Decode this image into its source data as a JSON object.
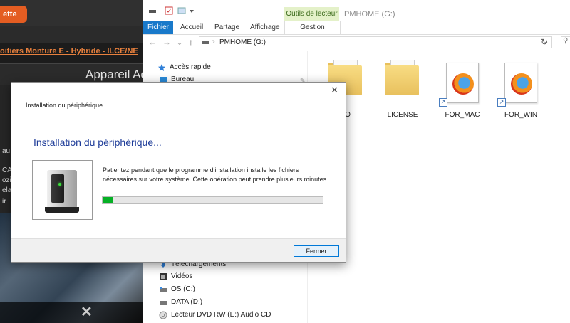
{
  "background_site": {
    "tab_label": "ette",
    "link_text": "oitiers Monture E - Hybride - ILCE/NE",
    "heading": "Appareil Ac",
    "side_text": [
      "au",
      "CAD",
      "ozil",
      "ela",
      "ir"
    ]
  },
  "explorer": {
    "tools_tab": "Outils de lecteur",
    "window_title": "PMHOME (G:)",
    "ribbon": {
      "file": "Fichier",
      "tabs": [
        "Accueil",
        "Partage",
        "Affichage"
      ],
      "gestion": "Gestion"
    },
    "address": {
      "path": "PMHOME (G:)"
    },
    "nav": {
      "quick_access": "Accès rapide",
      "bureau": "Bureau",
      "downloads": "Téléchargements",
      "videos": "Vidéos",
      "os": "OS (C:)",
      "data": "DATA (D:)",
      "dvd": "Lecteur DVD RW (E:) Audio CD"
    },
    "files": [
      {
        "label": "FO",
        "type": "folder"
      },
      {
        "label": "LICENSE",
        "type": "folder"
      },
      {
        "label": "FOR_MAC",
        "type": "firefox-shortcut"
      },
      {
        "label": "FOR_WIN",
        "type": "firefox-shortcut"
      }
    ]
  },
  "dialog": {
    "title": "Installation du périphérique",
    "heading": "Installation du périphérique...",
    "message": "Patientez pendant que le programme d'installation installe les fichiers nécessaires sur votre système. Cette opération peut prendre plusieurs minutes.",
    "progress": 0.05,
    "close_button": "Fermer",
    "colors": {
      "heading": "#1f3d99",
      "progress_fill": "#06b025"
    }
  }
}
